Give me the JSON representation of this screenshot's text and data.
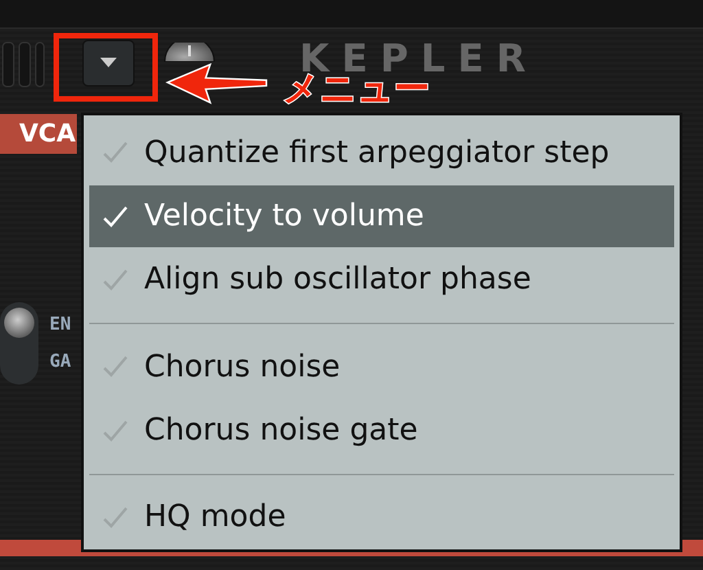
{
  "header": {
    "logo": "KEPLER",
    "vca_label": "VCA",
    "switch_labels": [
      "EN",
      "GA"
    ],
    "switch_on": true
  },
  "annotation": {
    "text": "メニュー"
  },
  "menu": {
    "groups": [
      {
        "items": [
          {
            "label": "Quantize first arpeggiator step",
            "checked": false,
            "highlighted": false
          },
          {
            "label": "Velocity to volume",
            "checked": true,
            "highlighted": true
          },
          {
            "label": "Align sub oscillator phase",
            "checked": false,
            "highlighted": false
          }
        ]
      },
      {
        "items": [
          {
            "label": "Chorus noise",
            "checked": false,
            "highlighted": false
          },
          {
            "label": "Chorus noise gate",
            "checked": false,
            "highlighted": false
          }
        ]
      },
      {
        "items": [
          {
            "label": "HQ mode",
            "checked": false,
            "highlighted": false
          }
        ]
      }
    ]
  }
}
